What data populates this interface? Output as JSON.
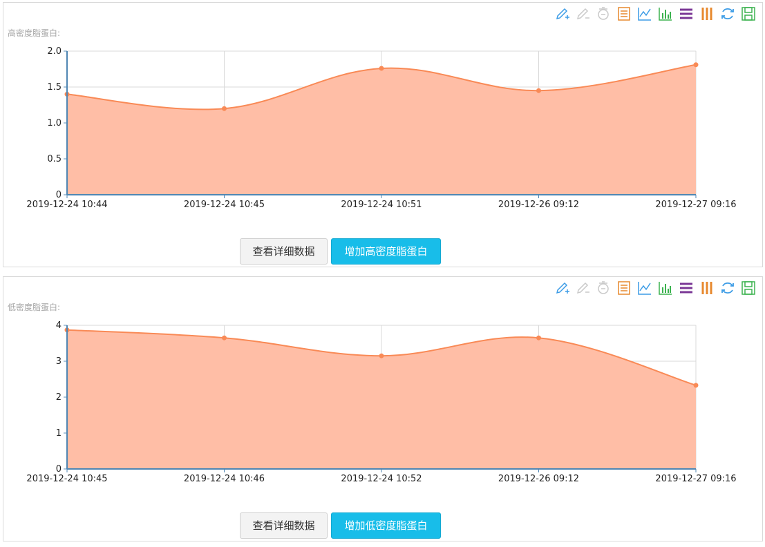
{
  "toolbox": {
    "icons": [
      "pencil-add-icon",
      "pencil-remove-icon",
      "trash-icon",
      "data-view-icon",
      "line-chart-icon",
      "bar-chart-icon",
      "stack-icon",
      "tiled-icon",
      "refresh-icon",
      "save-icon"
    ],
    "colors": [
      "#3c9ce6",
      "#c9c9c9",
      "#c9c9c9",
      "#e7882d",
      "#3c9ce6",
      "#3bb24f",
      "#7a3695",
      "#e7882d",
      "#3c9ce6",
      "#3bb24f"
    ]
  },
  "panels": [
    {
      "title": "高密度脂蛋白:",
      "buttons": {
        "detail": "查看详细数据",
        "add": "增加高密度脂蛋白"
      }
    },
    {
      "title": "低密度脂蛋白:",
      "buttons": {
        "detail": "查看详细数据",
        "add": "增加低密度脂蛋白"
      }
    }
  ],
  "chart_data": [
    {
      "type": "area",
      "title": "高密度脂蛋白:",
      "x": [
        "2019-12-24 10:44",
        "2019-12-24 10:45",
        "2019-12-24 10:51",
        "2019-12-26 09:12",
        "2019-12-27 09:16"
      ],
      "series": [
        {
          "values": [
            1.4,
            1.2,
            1.76,
            1.45,
            1.81
          ]
        }
      ],
      "ylim": [
        0,
        2.0
      ],
      "yticks": [
        "0",
        "0.5",
        "1.0",
        "1.5",
        "2.0"
      ],
      "grid": true,
      "colors": {
        "line": "#f98a56",
        "fill": "#ffbea6"
      }
    },
    {
      "type": "area",
      "title": "低密度脂蛋白:",
      "x": [
        "2019-12-24 10:45",
        "2019-12-24 10:46",
        "2019-12-24 10:52",
        "2019-12-26 09:12",
        "2019-12-27 09:16"
      ],
      "series": [
        {
          "values": [
            3.87,
            3.65,
            3.15,
            3.65,
            2.33
          ]
        }
      ],
      "ylim": [
        0,
        4
      ],
      "yticks": [
        "0",
        "1",
        "2",
        "3",
        "4"
      ],
      "grid": true,
      "colors": {
        "line": "#f98a56",
        "fill": "#ffbea6"
      }
    }
  ]
}
